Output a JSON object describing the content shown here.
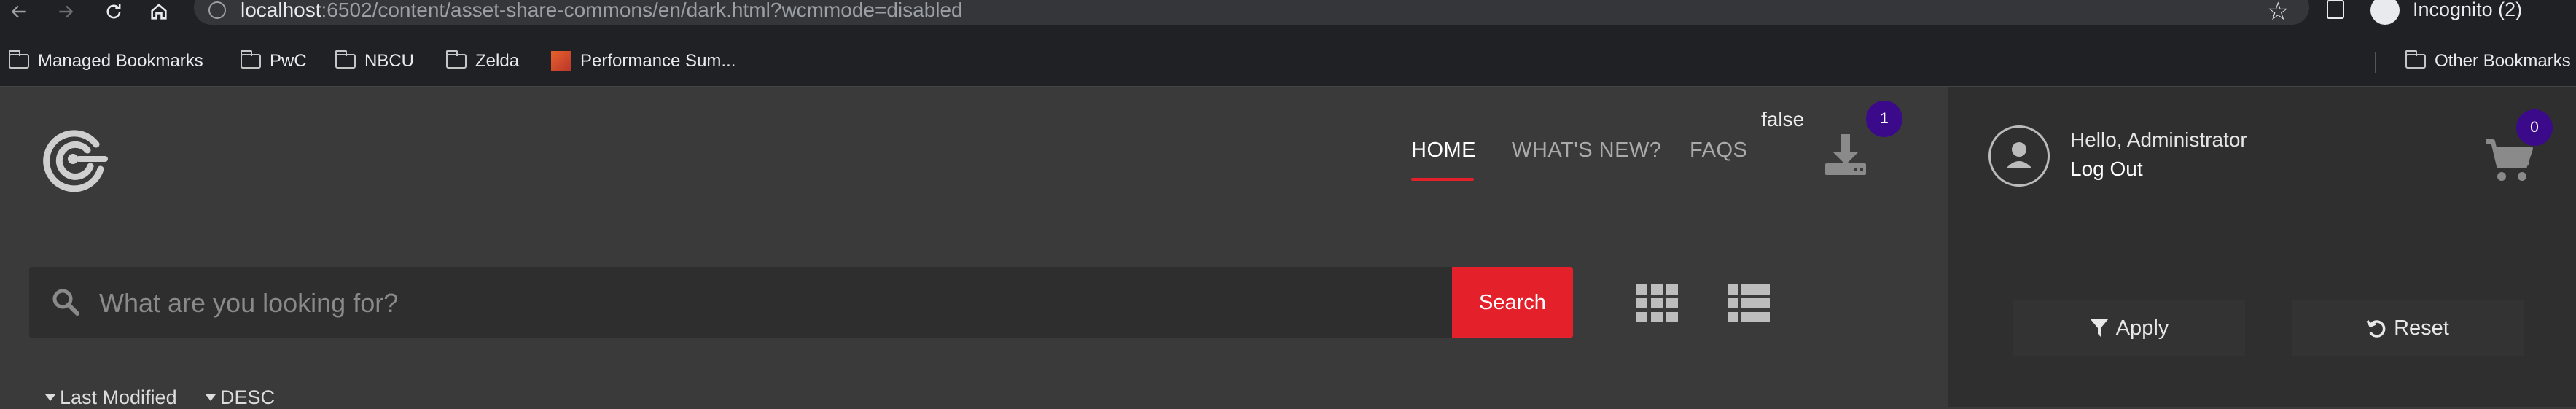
{
  "browser": {
    "url_host": "localhost",
    "url_rest": ":6502/content/asset-share-commons/en/dark.html?wcmmode=disabled",
    "profile_label": "Incognito (2)"
  },
  "bookmarks": {
    "items": [
      {
        "label": "Managed Bookmarks",
        "icon": "folder-icon"
      },
      {
        "label": "PwC",
        "icon": "folder-icon"
      },
      {
        "label": "NBCU",
        "icon": "folder-icon"
      },
      {
        "label": "Zelda",
        "icon": "folder-icon"
      },
      {
        "label": "Performance Sum...",
        "icon": "perf-icon"
      }
    ],
    "other": "Other Bookmarks"
  },
  "header": {
    "nav": [
      "HOME",
      "WHAT'S NEW?",
      "FAQS"
    ],
    "debug_text": "false",
    "download_count": "1"
  },
  "search": {
    "placeholder": "What are you looking for?",
    "button_label": "Search"
  },
  "sort": {
    "field": "Last Modified",
    "order": "DESC"
  },
  "user": {
    "greeting": "Hello, Administrator",
    "logout": "Log Out",
    "cart_count": "0"
  },
  "filters": {
    "apply": "Apply",
    "reset": "Reset"
  },
  "colors": {
    "accent": "#e4202b",
    "badge": "#3b0a8a",
    "background": "#3a3a3a"
  }
}
